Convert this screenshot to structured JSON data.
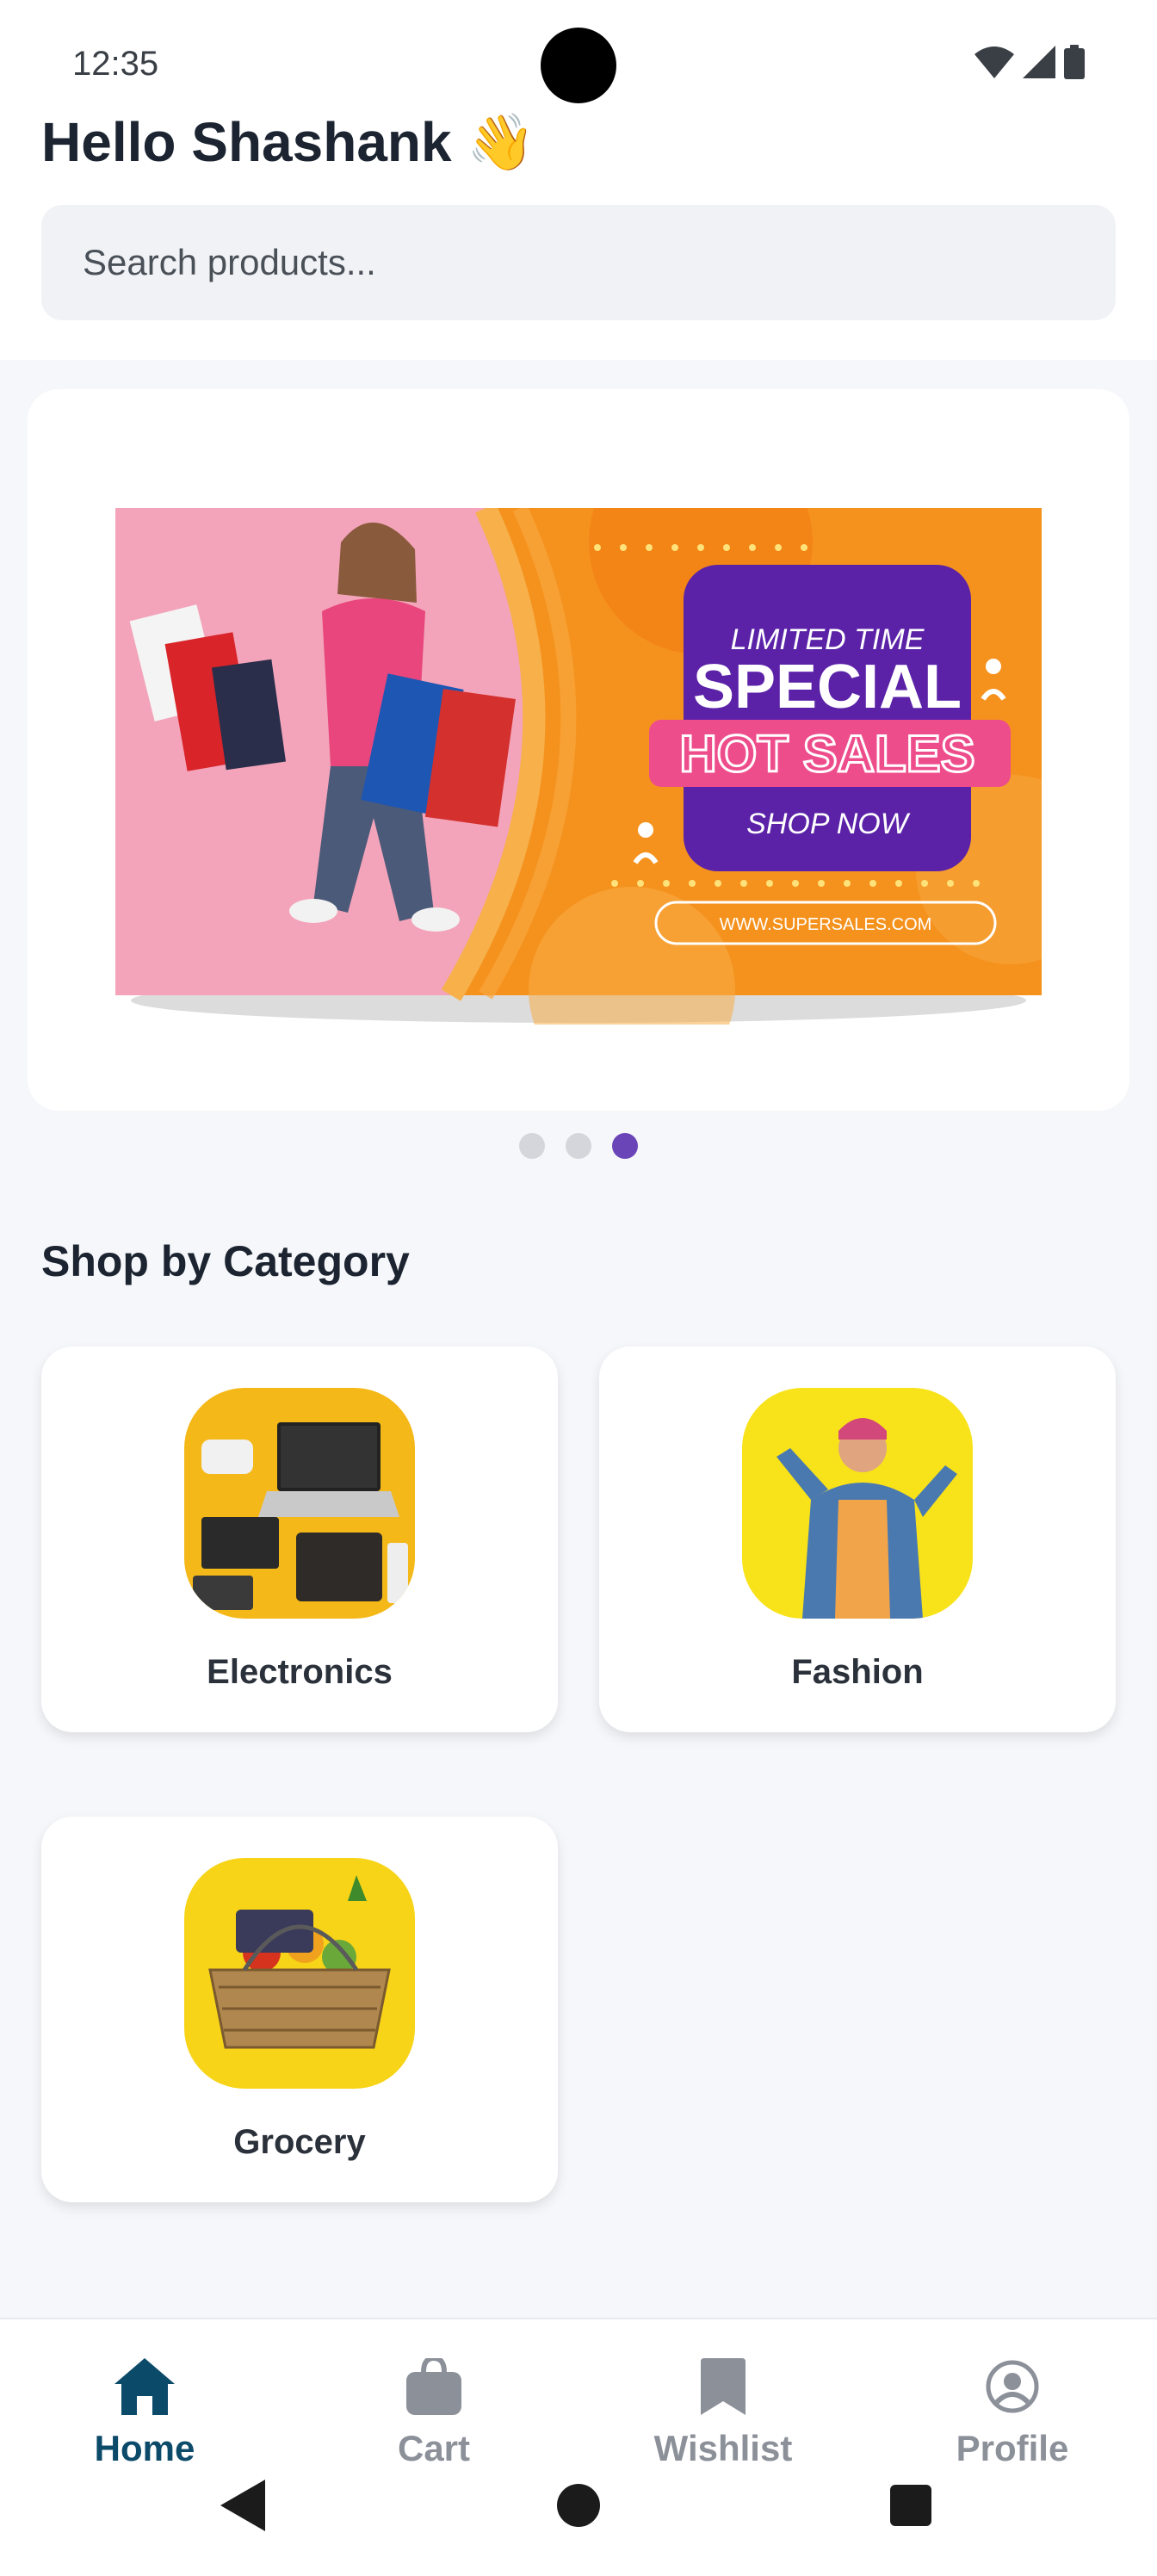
{
  "status_bar": {
    "time": "12:35"
  },
  "header": {
    "greeting": "Hello Shashank 👋"
  },
  "search": {
    "placeholder": "Search products..."
  },
  "banner": {
    "line1": "LIMITED TIME",
    "line2": "SPECIAL",
    "line3": "HOT SALES",
    "cta": "SHOP NOW",
    "url": "WWW.SUPERSALES.COM",
    "slide_count": 3,
    "active_slide": 3
  },
  "categories": {
    "title": "Shop by Category",
    "items": [
      {
        "label": "Electronics"
      },
      {
        "label": "Fashion"
      },
      {
        "label": "Grocery"
      }
    ]
  },
  "bottom_nav": {
    "items": [
      {
        "label": "Home",
        "icon": "home-icon",
        "active": true
      },
      {
        "label": "Cart",
        "icon": "bag-icon",
        "active": false
      },
      {
        "label": "Wishlist",
        "icon": "bookmark-icon",
        "active": false
      },
      {
        "label": "Profile",
        "icon": "profile-icon",
        "active": false
      }
    ]
  },
  "colors": {
    "accent": "#6a45b8",
    "nav_active": "#0c4a6a",
    "nav_inactive": "#8c9099",
    "banner_orange": "#f5921e",
    "banner_pink": "#f2a0b8",
    "category_yellow": "#f6d21d"
  }
}
